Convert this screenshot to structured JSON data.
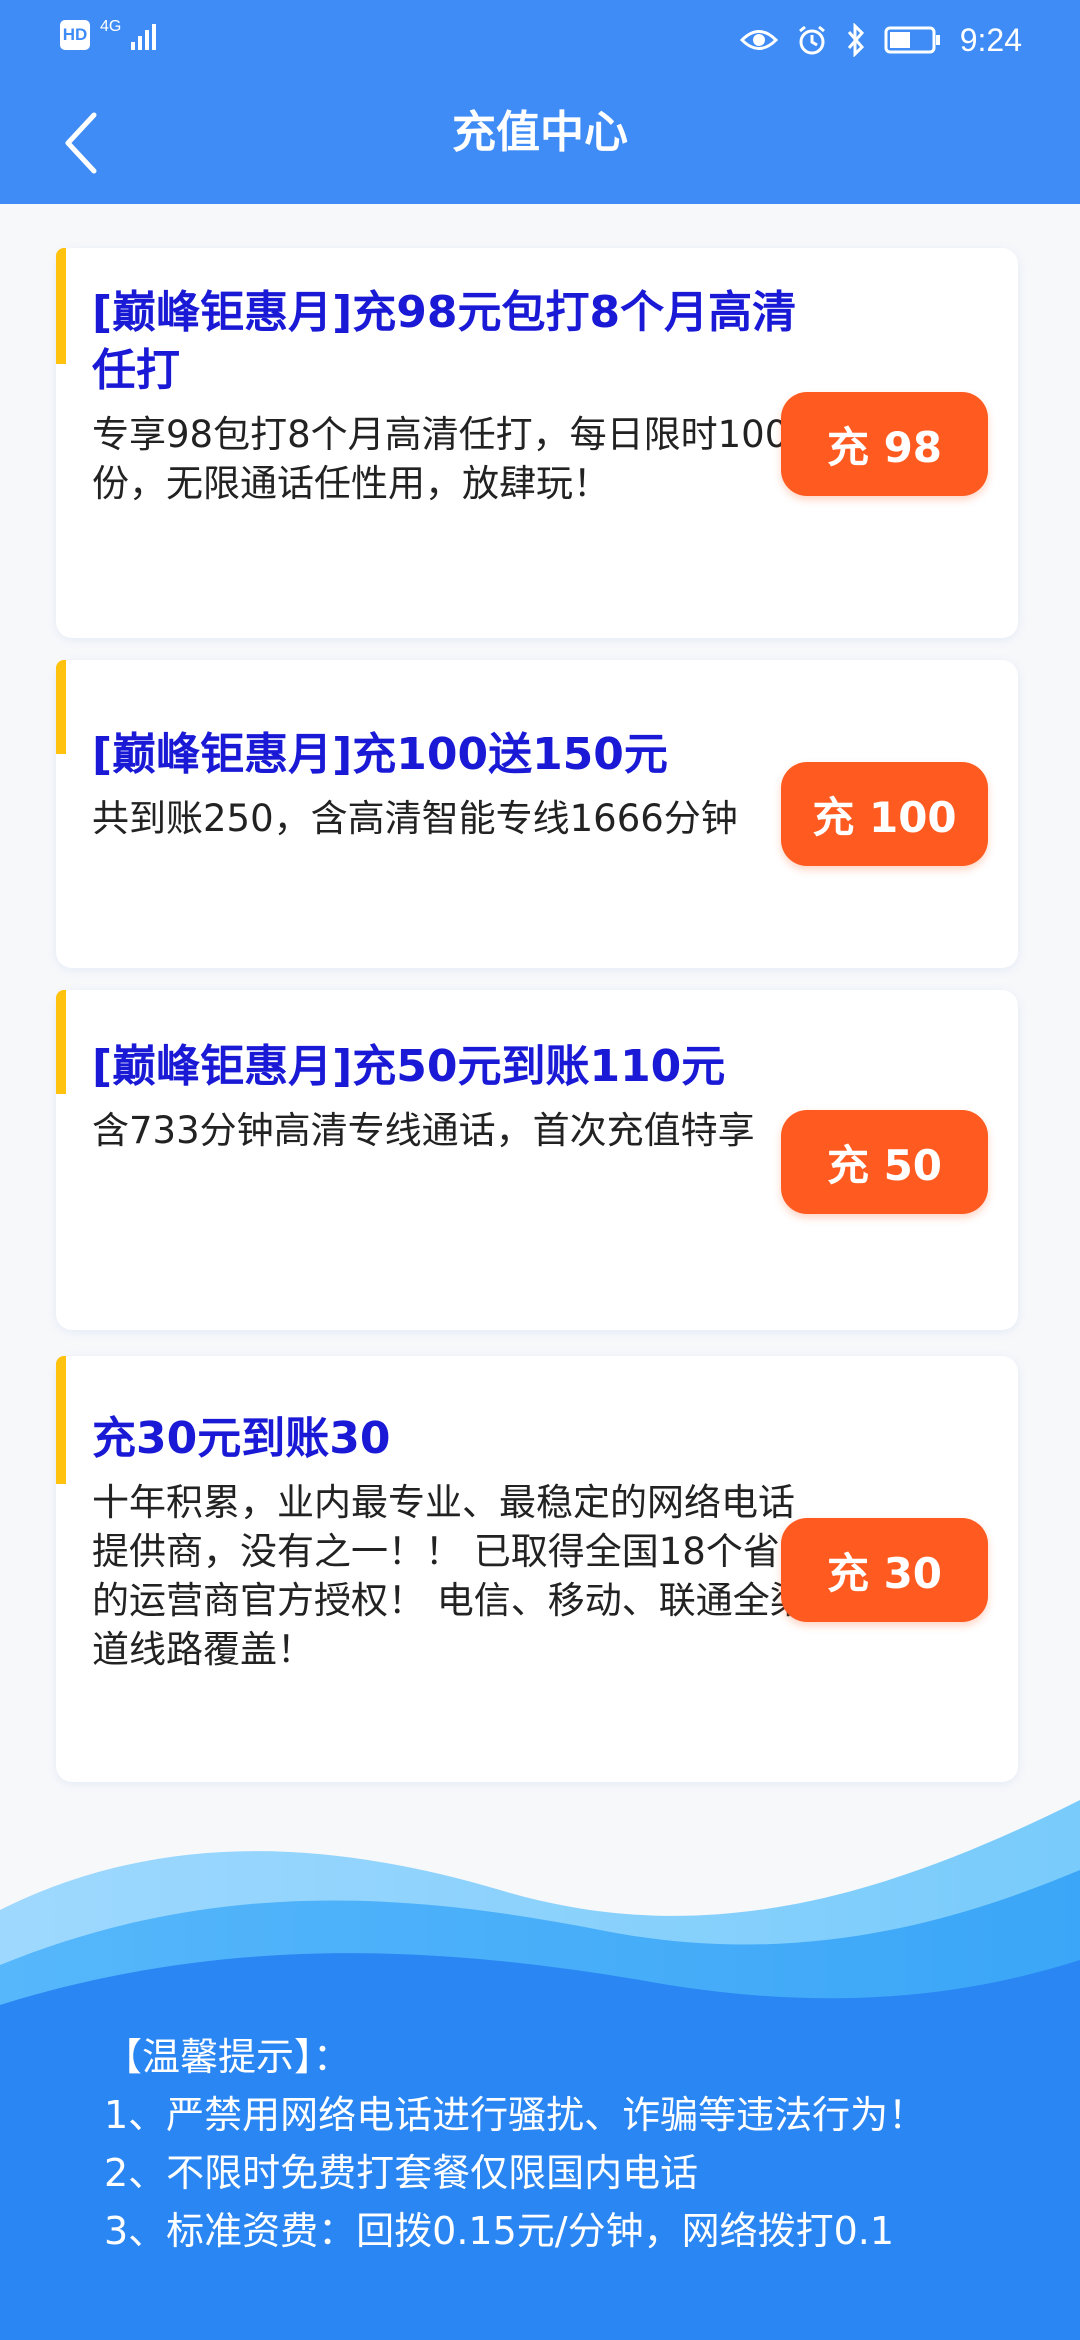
{
  "status_bar": {
    "hd_label": "HD",
    "network_label": "4G",
    "time": "9:24",
    "icons": [
      "eye-icon",
      "alarm-icon",
      "bluetooth-icon",
      "battery-icon"
    ]
  },
  "header": {
    "title": "充值中心",
    "back_icon": "chevron-left-icon"
  },
  "plans": [
    {
      "title": "[巅峰钜惠月]充98元包打8个月高清任打",
      "description": "专享98包打8个月高清任打，每日限时100份，无限通话任性用，放肆玩！",
      "button_label": "充 98"
    },
    {
      "title": "[巅峰钜惠月]充100送150元",
      "description": "共到账250，含高清智能专线1666分钟",
      "button_label": "充 100"
    },
    {
      "title": "[巅峰钜惠月]充50元到账110元",
      "description": "含733分钟高清专线通话，首次充值特享",
      "button_label": "充 50"
    },
    {
      "title": "充30元到账30",
      "description": "十年积累，业内最专业、最稳定的网络电话提供商，没有之一！！ 已取得全国18个省的运营商官方授权！ 电信、移动、联通全渠道线路覆盖！",
      "button_label": "充 30"
    }
  ],
  "tips": {
    "heading": "【温馨提示】：",
    "items": [
      "1、严禁用网络电话进行骚扰、诈骗等违法行为！",
      "2、不限时免费打套餐仅限国内电话",
      "3、标准资费：回拨0.15元/分钟，网络拨打0.1"
    ]
  },
  "colors": {
    "header_bg": "#3f8cf6",
    "title_blue": "#1a1ad6",
    "button_orange": "#ff5a1f",
    "accent_yellow": "#ffc20e",
    "wave_blue": "#2a86f2"
  }
}
